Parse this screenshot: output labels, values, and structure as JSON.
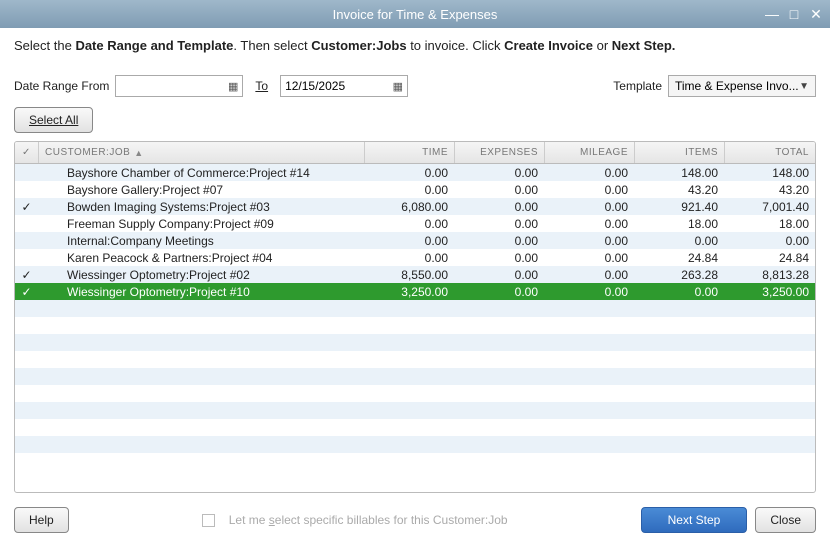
{
  "window": {
    "title": "Invoice for Time & Expenses"
  },
  "instruction": {
    "t1": "Select the ",
    "b1": "Date Range and Template",
    "t2": ". Then select ",
    "b2": "Customer:Jobs",
    "t3": " to invoice. Click ",
    "b3": "Create Invoice",
    "t4": " or ",
    "b4": "Next Step."
  },
  "filters": {
    "date_range_from_label": "Date Range From",
    "from_value": "",
    "to_label": "To",
    "to_value": "12/15/2025",
    "template_label": "Template",
    "template_value": "Time & Expense Invo..."
  },
  "buttons": {
    "select_all": "Select All",
    "help": "Help",
    "next_step": "Next Step",
    "close": "Close"
  },
  "columns": {
    "check": "✓",
    "customer": "CUSTOMER:JOB",
    "time": "TIME",
    "expenses": "EXPENSES",
    "mileage": "MILEAGE",
    "items": "ITEMS",
    "total": "TOTAL"
  },
  "rows": [
    {
      "checked": false,
      "customer": "Bayshore Chamber of Commerce:Project #14",
      "time": "0.00",
      "expenses": "0.00",
      "mileage": "0.00",
      "items": "148.00",
      "total": "148.00",
      "selected": false
    },
    {
      "checked": false,
      "customer": "Bayshore Gallery:Project #07",
      "time": "0.00",
      "expenses": "0.00",
      "mileage": "0.00",
      "items": "43.20",
      "total": "43.20",
      "selected": false
    },
    {
      "checked": true,
      "customer": "Bowden Imaging Systems:Project #03",
      "time": "6,080.00",
      "expenses": "0.00",
      "mileage": "0.00",
      "items": "921.40",
      "total": "7,001.40",
      "selected": false
    },
    {
      "checked": false,
      "customer": "Freeman Supply Company:Project #09",
      "time": "0.00",
      "expenses": "0.00",
      "mileage": "0.00",
      "items": "18.00",
      "total": "18.00",
      "selected": false
    },
    {
      "checked": false,
      "customer": "Internal:Company Meetings",
      "time": "0.00",
      "expenses": "0.00",
      "mileage": "0.00",
      "items": "0.00",
      "total": "0.00",
      "selected": false
    },
    {
      "checked": false,
      "customer": "Karen Peacock & Partners:Project #04",
      "time": "0.00",
      "expenses": "0.00",
      "mileage": "0.00",
      "items": "24.84",
      "total": "24.84",
      "selected": false
    },
    {
      "checked": true,
      "customer": "Wiessinger Optometry:Project #02",
      "time": "8,550.00",
      "expenses": "0.00",
      "mileage": "0.00",
      "items": "263.28",
      "total": "8,813.28",
      "selected": false
    },
    {
      "checked": true,
      "customer": "Wiessinger Optometry:Project #10",
      "time": "3,250.00",
      "expenses": "0.00",
      "mileage": "0.00",
      "items": "0.00",
      "total": "3,250.00",
      "selected": true
    }
  ],
  "footer": {
    "billables_label": "Let me select specific billables for this Customer:Job"
  }
}
